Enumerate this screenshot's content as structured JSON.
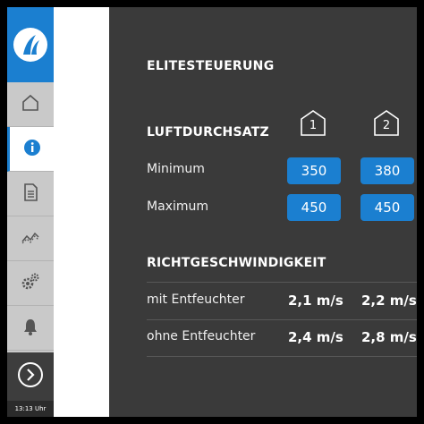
{
  "sidebar": {
    "items": [
      {
        "icon": "home-icon"
      },
      {
        "icon": "info-icon",
        "active": true
      },
      {
        "icon": "document-icon"
      },
      {
        "icon": "trend-chart-icon"
      },
      {
        "icon": "settings-gears-icon"
      },
      {
        "icon": "bell-icon"
      }
    ],
    "next_icon": "chevron-right-circle-icon",
    "time": "13:13 Uhr"
  },
  "colors": {
    "accent": "#1b7fd0",
    "panel": "#3a3a3a",
    "sidebar": "#c9c9c9"
  },
  "main": {
    "title": "ELITESTEUERUNG",
    "zones": [
      "1",
      "2"
    ],
    "airflow": {
      "heading": "LUFTDURCHSATZ",
      "rows": [
        {
          "label": "Minimum",
          "values": [
            "350",
            "380"
          ]
        },
        {
          "label": "Maximum",
          "values": [
            "450",
            "450"
          ]
        }
      ]
    },
    "speed": {
      "heading": "RICHTGESCHWINDIGKEIT",
      "rows": [
        {
          "label": "mit Entfeuchter",
          "values": [
            "2,1 m/s",
            "2,2 m/s"
          ]
        },
        {
          "label": "ohne Entfeuchter",
          "values": [
            "2,4 m/s",
            "2,8 m/s"
          ]
        }
      ]
    }
  }
}
